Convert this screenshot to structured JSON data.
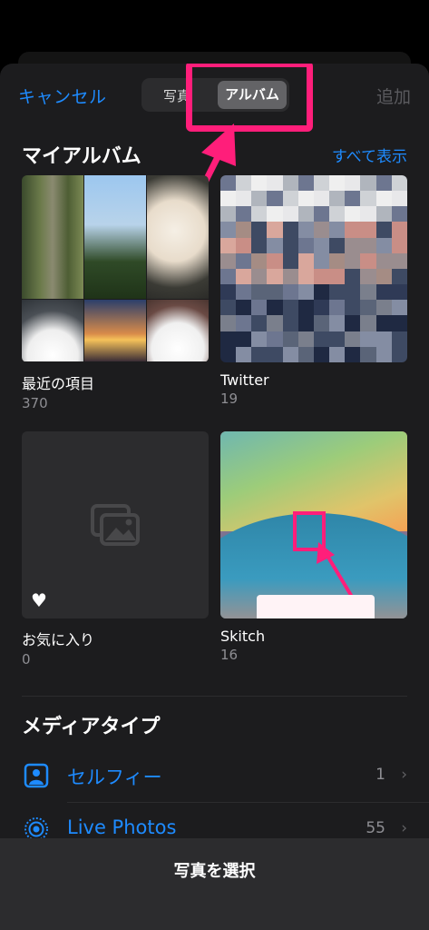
{
  "header": {
    "cancel_label": "キャンセル",
    "add_label": "追加",
    "segments": {
      "photos": "写真",
      "albums": "アルバム"
    }
  },
  "my_albums": {
    "title": "マイアルバム",
    "see_all": "すべて表示",
    "albums": [
      {
        "name": "最近の項目",
        "count": "370"
      },
      {
        "name": "Twitter",
        "count": "19"
      },
      {
        "name": "お気に入り",
        "count": "0"
      },
      {
        "name": "Skitch",
        "count": "16"
      }
    ]
  },
  "media_types": {
    "title": "メディアタイプ",
    "items": [
      {
        "label": "セルフィー",
        "count": "1",
        "icon": "selfie-icon"
      },
      {
        "label": "Live Photos",
        "count": "55",
        "icon": "live-photos-icon"
      }
    ]
  },
  "bottom": {
    "label": "写真を選択"
  },
  "colors": {
    "accent": "#1e8bff",
    "callout": "#ff1e7a",
    "sheet_bg": "#1c1c1e"
  }
}
